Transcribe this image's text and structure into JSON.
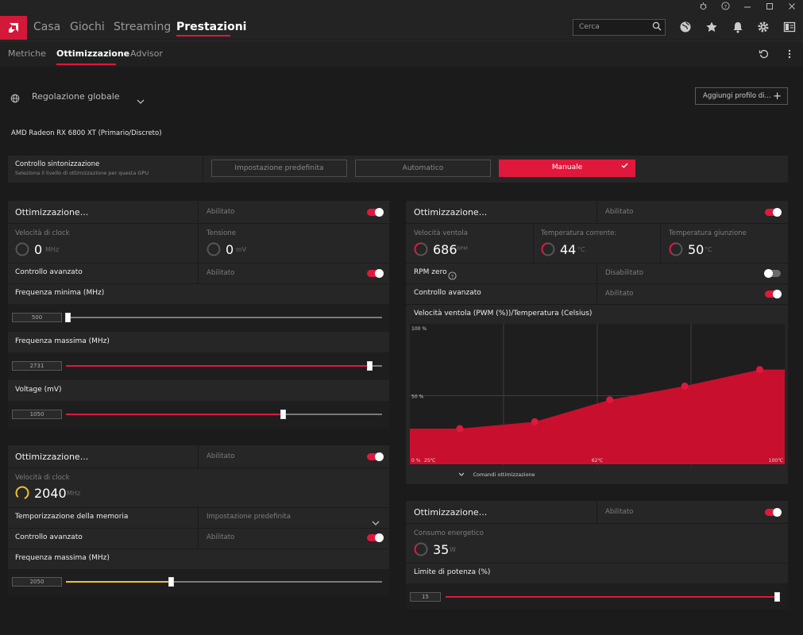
{
  "window_controls": {
    "bug": "bug-icon",
    "help": "help-icon",
    "minimize": "minimize-icon",
    "maximize": "maximize-icon",
    "close": "close-icon"
  },
  "nav": {
    "tabs": [
      "Casa",
      "Giochi",
      "Streaming",
      "Prestazioni"
    ],
    "active": "Prestazioni"
  },
  "search": {
    "placeholder": "Cerca"
  },
  "topicons": [
    "globe-icon",
    "star-icon",
    "bell-icon",
    "gear-icon",
    "layout-icon"
  ],
  "subnav": {
    "tabs": [
      "Metriche",
      "Ottimizzazione",
      "Advisor"
    ],
    "active": "Ottimizzazione"
  },
  "profile": {
    "label": "Regolazione globale",
    "add_button": "Aggiungi profilo di..."
  },
  "gpu_name": "AMD Radeon RX 6800 XT (Primario/Discreto)",
  "tuning_control": {
    "title": "Controllo sintonizzazione",
    "subtitle": "Seleziona il livello di ottimizzazione per questa GPU",
    "options": [
      "Impostazione predefinita",
      "Automatico",
      "Manuale"
    ],
    "selected": "Manuale"
  },
  "gpu_panel": {
    "title": "Ottimizzazione...",
    "status": "Abilitato",
    "enabled": true,
    "clock": {
      "label": "Velocità di clock",
      "value": "0",
      "unit": "MHz"
    },
    "voltage": {
      "label": "Tensione",
      "value": "0",
      "unit": "mV"
    },
    "advanced": {
      "label": "Controllo avanzato",
      "status": "Abilitato",
      "enabled": true
    },
    "min_freq": {
      "label": "Frequenza minima (MHz)",
      "value": "500",
      "level": 0.0
    },
    "max_freq": {
      "label": "Frequenza massima (MHz)",
      "value": "2731",
      "level": 0.97
    },
    "voltage_slider": {
      "label": "Voltage (mV)",
      "value": "1050",
      "level": 0.69
    }
  },
  "vram_panel": {
    "title": "Ottimizzazione...",
    "status": "Abilitato",
    "enabled": true,
    "clock": {
      "label": "Velocità di clock",
      "value": "2040",
      "unit": "MHz"
    },
    "timing": {
      "label": "Temporizzazione della memoria",
      "value": "Impostazione predefinita"
    },
    "advanced": {
      "label": "Controllo avanzato",
      "status": "Abilitato",
      "enabled": true
    },
    "max_freq": {
      "label": "Frequenza massima (MHz)",
      "value": "2050",
      "level": 0.29
    }
  },
  "fan_panel": {
    "title": "Ottimizzazione...",
    "status": "Abilitato",
    "enabled": true,
    "fan_speed": {
      "label": "Velocità ventola",
      "value": "686",
      "unit": "RPM"
    },
    "current_temp": {
      "label": "Temperatura corrente:",
      "value": "44",
      "unit": "°C"
    },
    "junction_temp": {
      "label": "Temperatura giunzione",
      "value": "50",
      "unit": "°C"
    },
    "zero_rpm": {
      "label": "RPM zero",
      "status": "Disabilitato",
      "enabled": false
    },
    "advanced": {
      "label": "Controllo avanzato",
      "status": "Abilitato",
      "enabled": true
    },
    "chart_title": "Velocità ventola (PWM (%))/Temperatura (Celsius)",
    "tuning_commands": "Comandi ottimizzazione"
  },
  "power_panel": {
    "title": "Ottimizzazione...",
    "status": "Abilitato",
    "enabled": true,
    "consumption": {
      "label": "Consumo energetico",
      "value": "35",
      "unit": "W"
    },
    "limit": {
      "label": "Limite di potenza (%)",
      "value": "15",
      "level": 1.0
    }
  },
  "chart_data": {
    "type": "area",
    "title": "Velocità ventola (PWM (%))/Temperatura (Celsius)",
    "x_tick_labels": [
      "25℃",
      "62℃",
      "100℃"
    ],
    "y_tick_labels": [
      "0 %",
      "50 %",
      "100 %"
    ],
    "xlim": [
      25,
      100
    ],
    "ylim": [
      0,
      100
    ],
    "grid": true,
    "series": [
      {
        "x": [
          35,
          50,
          65,
          80,
          95
        ],
        "y": [
          26,
          31,
          47,
          57,
          69
        ]
      }
    ],
    "color": "#c8102e"
  },
  "colors": {
    "accent": "#e0183c",
    "memory_slider": "#f0c030"
  }
}
